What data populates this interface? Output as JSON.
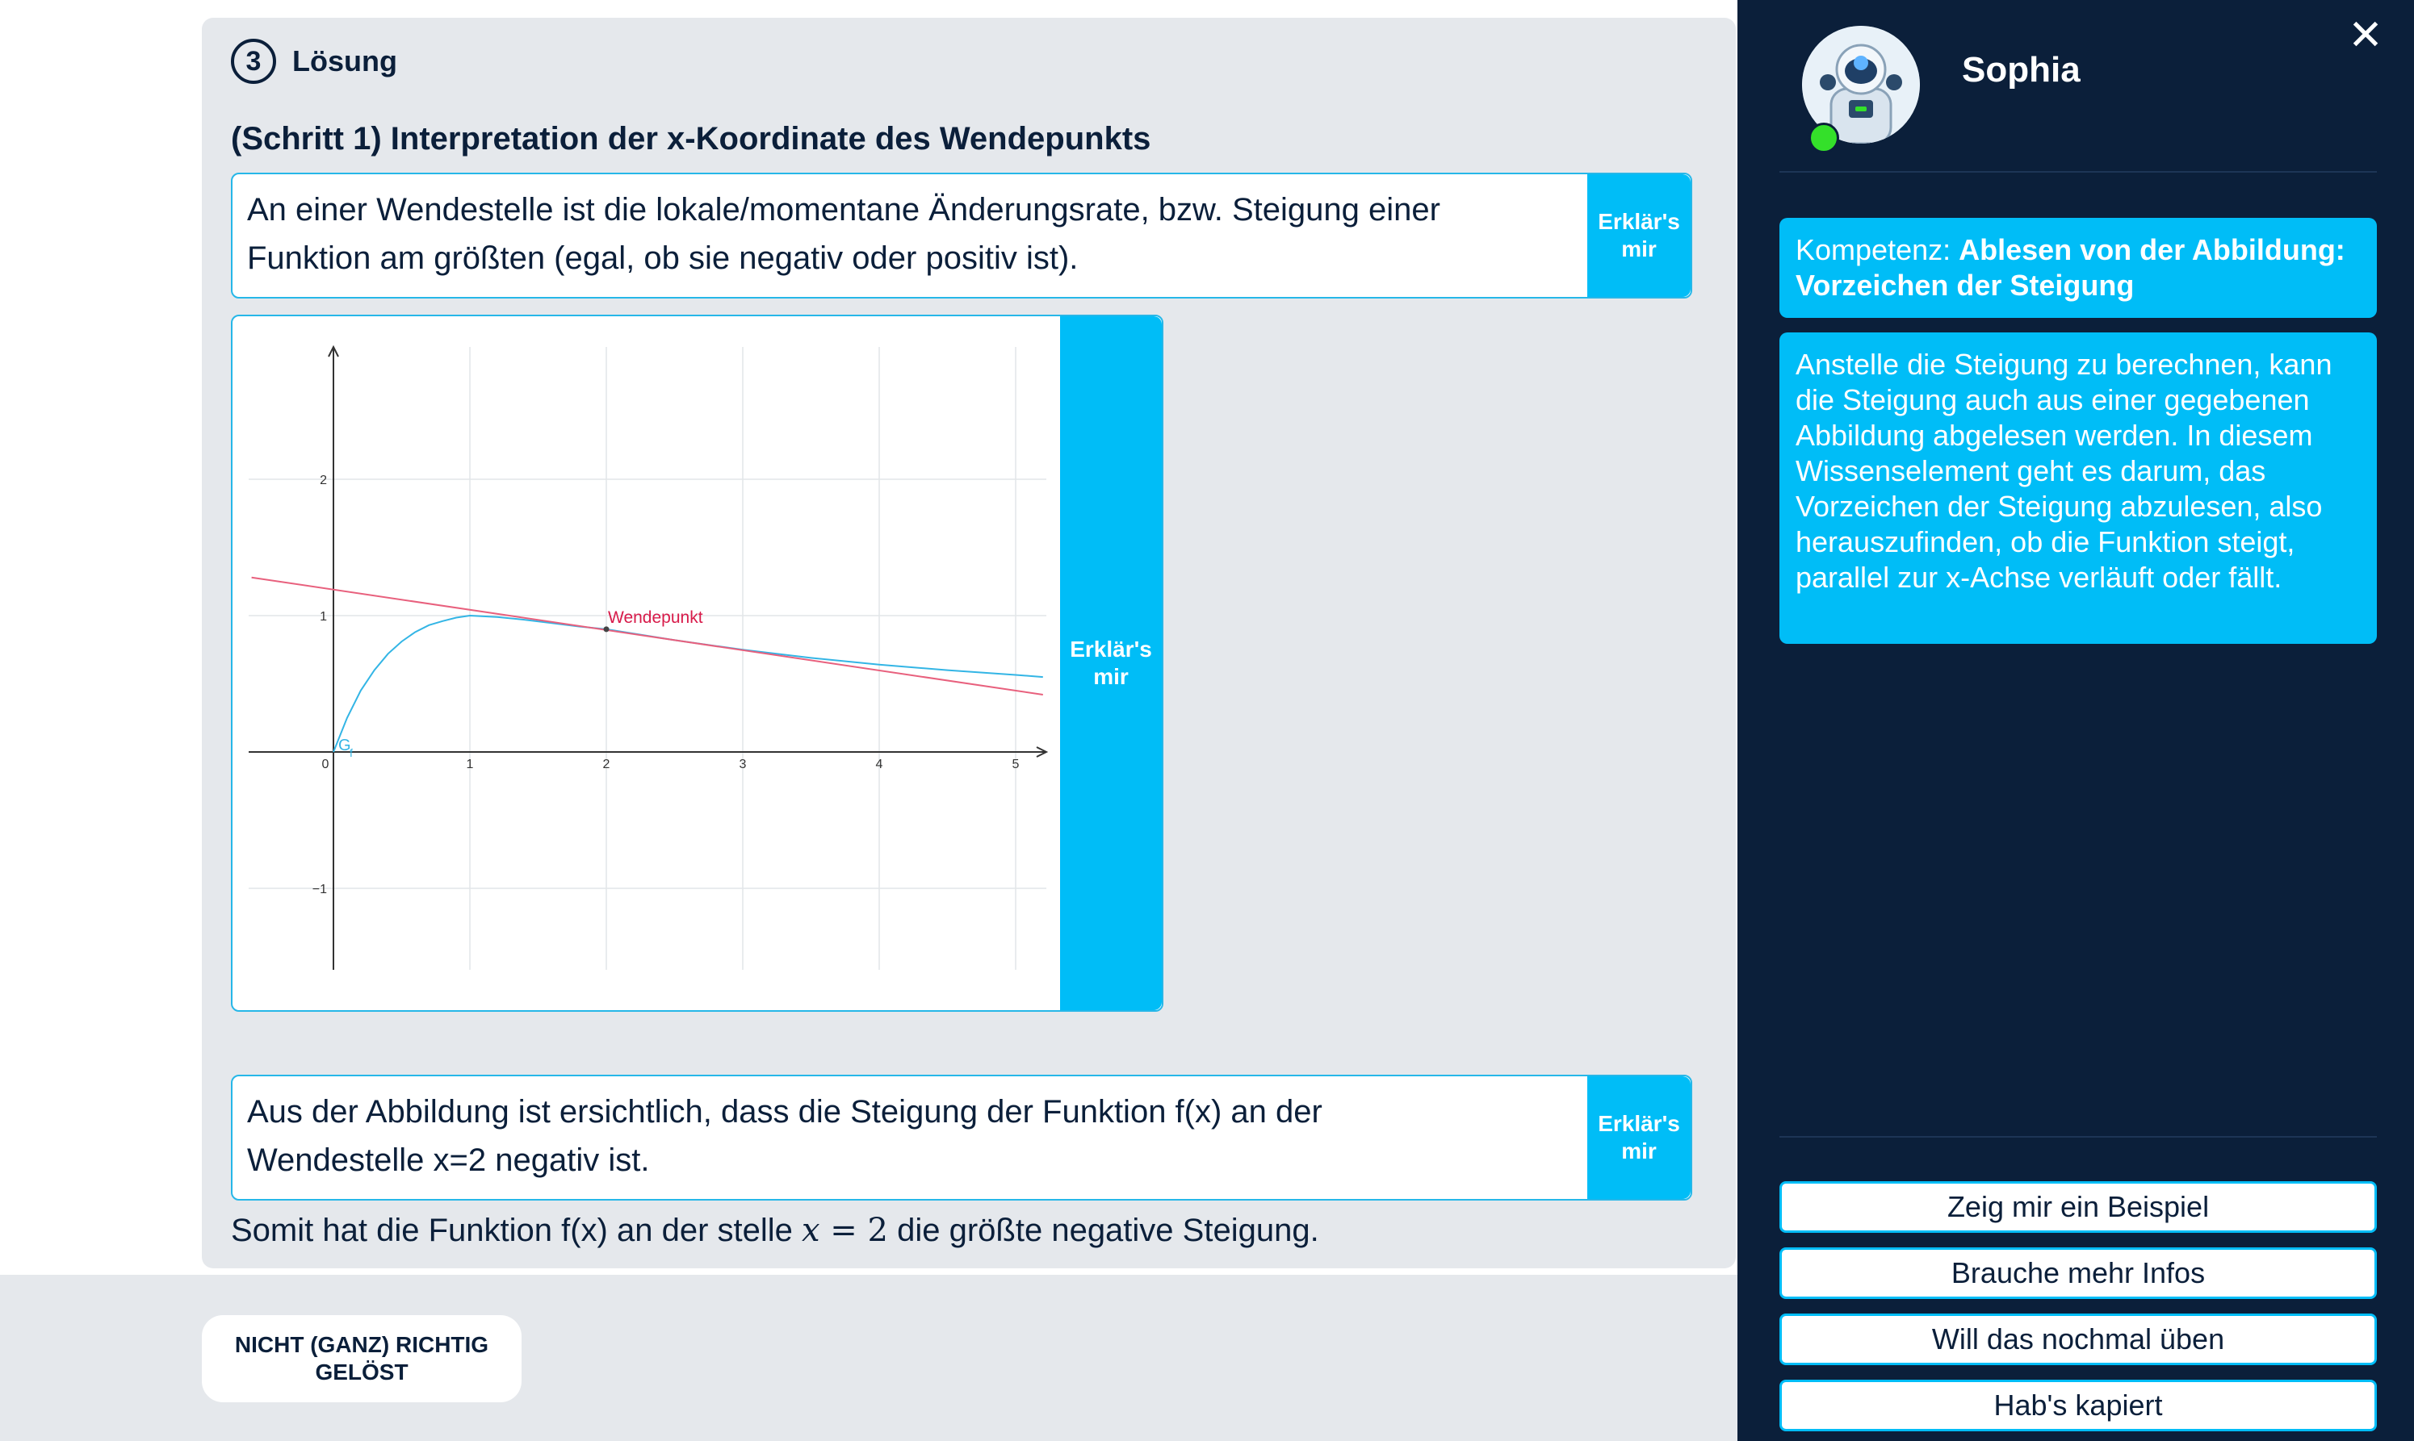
{
  "solution": {
    "step_number": "3",
    "section_title": "Lösung",
    "step_title": "(Schritt 1) Interpretation der x-Koordinate des Wendepunkts",
    "paragraph1": "An einer Wendestelle ist die lokale/momentane Änderungsrate, bzw. Steigung einer Funktion am größten (egal, ob sie negativ oder positiv ist).",
    "paragraph2": "Aus der Abbildung ist ersichtlich, dass die Steigung der Funktion f(x) an der Wendestelle x=2 negativ ist.",
    "summary_before": "Somit hat die Funktion f(x) an der stelle",
    "summary_math_var": "x",
    "summary_math_eq": " = 2",
    "summary_after": "die größte negative Steigung.",
    "explain_label_1": "Erklär's",
    "explain_label_2": "mir",
    "wrong_button_line1": "NICHT (GANZ) RICHTIG",
    "wrong_button_line2": "GELÖST"
  },
  "chart_data": {
    "type": "line",
    "xlim": [
      -0.6,
      5.2
    ],
    "ylim": [
      -1.6,
      2.95
    ],
    "x_ticks": [
      "0",
      "1",
      "2",
      "3",
      "4",
      "5"
    ],
    "y_ticks": [
      "2",
      "1",
      "−1"
    ],
    "grid": true,
    "series": [
      {
        "name": "G_f",
        "label": "G",
        "label_sub": "f",
        "color": "#33b5e5",
        "x": [
          0,
          0.1,
          0.2,
          0.3,
          0.4,
          0.5,
          0.6,
          0.7,
          0.8,
          0.9,
          1.0,
          1.2,
          1.4,
          1.6,
          1.8,
          2.0,
          2.5,
          3.0,
          3.5,
          4.0,
          4.5,
          5.0,
          5.2
        ],
        "y": [
          0,
          0.25,
          0.45,
          0.6,
          0.72,
          0.81,
          0.88,
          0.93,
          0.96,
          0.985,
          1.0,
          0.99,
          0.97,
          0.945,
          0.92,
          0.9,
          0.82,
          0.75,
          0.69,
          0.64,
          0.6,
          0.565,
          0.55
        ]
      },
      {
        "name": "Tangente",
        "color": "#e8607d",
        "x": [
          -0.6,
          5.2
        ],
        "y": [
          1.28,
          0.42
        ]
      }
    ],
    "annotations": [
      {
        "text": "Wendepunkt",
        "x": 2,
        "y": 0.9,
        "color": "#d81b4a"
      }
    ]
  },
  "tutor": {
    "name": "Sophia",
    "close_icon": "close-icon",
    "competence_prefix": "Kompetenz: ",
    "competence_title": "Ablesen von der Abbildung: Vorzeichen der Steigung",
    "info_text": "Anstelle die Steigung zu berechnen, kann die Steigung auch aus einer gegebenen Abbildung abgelesen werden. In diesem Wissenselement geht es darum, das Vorzeichen der Steigung abzulesen, also herauszufinden, ob die Funktion steigt, parallel zur x-Achse verläuft oder fällt.",
    "actions": [
      "Zeig mir ein Beispiel",
      "Brauche mehr Infos",
      "Will das nochmal üben",
      "Hab's kapiert"
    ]
  },
  "colors": {
    "accent": "#00bdf7",
    "panel_bg": "#0b1f3a",
    "online": "#34e02a"
  }
}
